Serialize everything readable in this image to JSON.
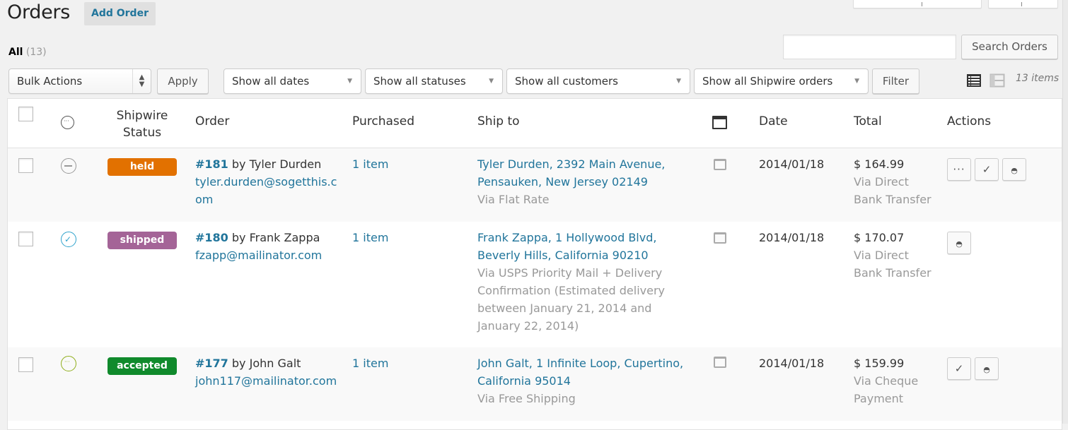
{
  "header": {
    "title": "Orders",
    "add_button": "Add Order"
  },
  "views": {
    "all_label": "All",
    "all_count": "(13)"
  },
  "search": {
    "value": "",
    "placeholder": "",
    "button": "Search Orders"
  },
  "filters": {
    "bulk_actions": "Bulk Actions",
    "apply": "Apply",
    "dates": "Show all dates",
    "statuses": "Show all statuses",
    "customers": "Show all customers",
    "shipwire": "Show all Shipwire orders",
    "filter": "Filter",
    "items_count": "13 items"
  },
  "columns": {
    "shipwire_status_line1": "Shipwire",
    "shipwire_status_line2": "Status",
    "order": "Order",
    "purchased": "Purchased",
    "ship_to": "Ship to",
    "date": "Date",
    "total": "Total",
    "actions": "Actions"
  },
  "colors": {
    "link": "#21759b",
    "held": "#e27100",
    "shipped": "#a46497",
    "accepted": "#108a2c"
  },
  "orders": [
    {
      "status_icon": "minus-circle-icon",
      "shipwire_status": "held",
      "order_number": "#181",
      "by": " by Tyler Durden",
      "email": "tyler.durden@sogetthis.com",
      "purchased": "1 item",
      "address_line1": "Tyler Durden, 2392 Main Avenue,",
      "address_line2": "Pensauken, New Jersey 02149",
      "shipping": "Via Flat Rate",
      "date": "2014/01/18",
      "total": "$ 164.99",
      "payment": "Via Direct Bank Transfer",
      "actions": [
        "processing",
        "complete",
        "view"
      ]
    },
    {
      "status_icon": "check-circle-icon",
      "shipwire_status": "shipped",
      "order_number": "#180",
      "by": " by Frank Zappa",
      "email": "fzapp@mailinator.com",
      "purchased": "1 item",
      "address_line1": "Frank Zappa, 1 Hollywood Blvd,",
      "address_line2": "Beverly Hills, California 90210",
      "shipping": "Via USPS Priority Mail + Delivery Confirmation (Estimated delivery between January 21, 2014 and January 22, 2014)",
      "date": "2014/01/18",
      "total": "$ 170.07",
      "payment": "Via Direct Bank Transfer",
      "actions": [
        "view"
      ]
    },
    {
      "status_icon": "ellipsis-circle-icon",
      "shipwire_status": "accepted",
      "order_number": "#177",
      "by": " by John Galt",
      "email": "john117@mailinator.com",
      "purchased": "1 item",
      "address_line1": "John Galt, 1 Infinite Loop, Cupertino,",
      "address_line2": "California 95014",
      "shipping": "Via Free Shipping",
      "date": "2014/01/18",
      "total": "$ 159.99",
      "payment": "Via Cheque Payment",
      "actions": [
        "complete",
        "view"
      ]
    }
  ]
}
